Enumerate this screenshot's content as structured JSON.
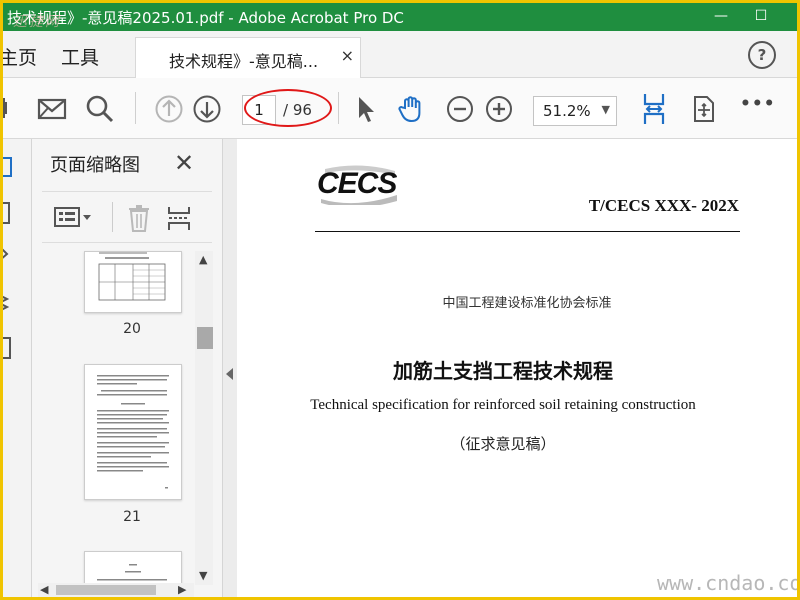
{
  "window": {
    "title": "技术规程》-意见稿2025.01.pdf - Adobe Acrobat Pro DC",
    "watermark": "迅捷网",
    "minimize": "—",
    "maximize": "☐"
  },
  "menu": {
    "home": "主页",
    "tools": "工具",
    "tab_label": "技术规程》-意见稿...",
    "tab_close": "×",
    "help": "?"
  },
  "toolbar": {
    "current_page": "1",
    "total_pages": "/ 96",
    "zoom": "51.2%",
    "zoom_caret": "▼",
    "more": "•••"
  },
  "thumbnail_panel": {
    "title": "页面缩略图",
    "close": "✕",
    "pages": [
      {
        "label": "20"
      },
      {
        "label": "21"
      }
    ]
  },
  "document": {
    "logo_text": "CECS",
    "standard_number": "T/CECS XXX- 202X",
    "association": "中国工程建设标准化协会标准",
    "title_cn": "加筋土支挡工程技术规程",
    "title_en": "Technical specification for reinforced soil retaining construction",
    "draft_label": "（征求意见稿）"
  },
  "watermark_bottom": "www.cndao.com",
  "colors": {
    "titlebar": "#1f8e3f",
    "accent_blue": "#1f6fc5",
    "annotation_red": "#e01818",
    "border_yellow": "#f0c400"
  }
}
